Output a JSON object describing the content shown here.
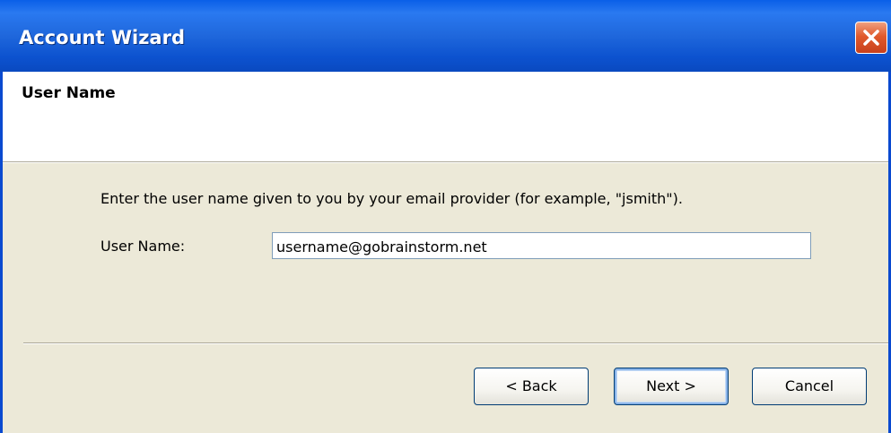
{
  "window": {
    "title": "Account Wizard"
  },
  "header": {
    "title": "User Name"
  },
  "form": {
    "instruction": "Enter the user name given to you by your email provider (for example, \"jsmith\").",
    "username_label": "User Name:",
    "username_value": "username@gobrainstorm.net"
  },
  "buttons": {
    "back_label": "< Back",
    "next_label": "Next >",
    "cancel_label": "Cancel"
  },
  "colors": {
    "titlebar": "#0a5fe8",
    "dialog_background": "#ece9d8",
    "close_button": "#e05a2c"
  },
  "icons": {
    "close": "close-icon"
  }
}
